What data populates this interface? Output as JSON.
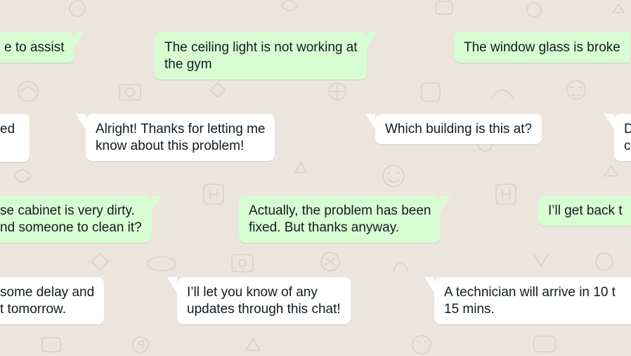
{
  "chat": {
    "wallpaper": "whatsapp-doodle-pattern",
    "colors": {
      "background": "#ece5dd",
      "incoming_bubble": "#ffffff",
      "outgoing_bubble": "#d9fdd3",
      "text": "#111b21"
    },
    "rows": [
      {
        "messages": [
          {
            "direction": "outgoing",
            "lines": [
              "e to assist"
            ]
          },
          {
            "direction": "outgoing",
            "lines": [
              "The ceiling light is not working at",
              "the gym"
            ]
          },
          {
            "direction": "outgoing",
            "lines": [
              "The window glass is broke"
            ]
          }
        ]
      },
      {
        "messages": [
          {
            "direction": "incoming",
            "lines": [
              "ed"
            ]
          },
          {
            "direction": "incoming",
            "lines": [
              "Alright! Thanks for letting me",
              "know about this problem!"
            ]
          },
          {
            "direction": "incoming",
            "lines": [
              "Which building is this at?"
            ]
          },
          {
            "direction": "incoming",
            "lines": [
              "D",
              "c"
            ]
          }
        ]
      },
      {
        "messages": [
          {
            "direction": "outgoing",
            "lines": [
              "se cabinet is very dirty.",
              "nd someone to clean it?"
            ]
          },
          {
            "direction": "outgoing",
            "lines": [
              "Actually, the problem has been",
              "fixed. But thanks anyway."
            ]
          },
          {
            "direction": "outgoing",
            "lines": [
              "I’ll get back t"
            ]
          }
        ]
      },
      {
        "messages": [
          {
            "direction": "incoming",
            "lines": [
              "some delay and",
              "t tomorrow."
            ]
          },
          {
            "direction": "incoming",
            "lines": [
              "I’ll let you know of any",
              "updates through this chat!"
            ]
          },
          {
            "direction": "incoming",
            "lines": [
              "A technician will arrive in 10 t",
              "15 mins."
            ]
          }
        ]
      }
    ]
  }
}
